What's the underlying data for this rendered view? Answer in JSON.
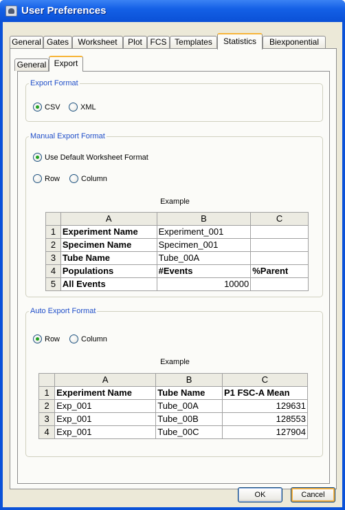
{
  "window": {
    "title": "User Preferences"
  },
  "top_tabs": [
    {
      "label": "General"
    },
    {
      "label": "Gates"
    },
    {
      "label": "Worksheet"
    },
    {
      "label": "Plot"
    },
    {
      "label": "FCS"
    },
    {
      "label": "Templates"
    },
    {
      "label": "Statistics",
      "active": true
    },
    {
      "label": "Biexponential"
    }
  ],
  "sub_tabs": [
    {
      "label": "General"
    },
    {
      "label": "Export",
      "active": true
    }
  ],
  "export_format": {
    "legend": "Export Format",
    "options": [
      {
        "label": "CSV",
        "selected": true
      },
      {
        "label": "XML",
        "selected": false
      }
    ]
  },
  "manual_export": {
    "legend": "Manual Export Format",
    "default_option": {
      "label": "Use Default Worksheet Format",
      "selected": true
    },
    "row_option": {
      "label": "Row",
      "selected": false
    },
    "column_option": {
      "label": "Column",
      "selected": false
    },
    "example_label": "Example",
    "table": {
      "columns": [
        "",
        "A",
        "B",
        "C"
      ],
      "rows": [
        [
          "1",
          "Experiment Name",
          "Experiment_001",
          ""
        ],
        [
          "2",
          "Specimen Name",
          "Specimen_001",
          ""
        ],
        [
          "3",
          "Tube Name",
          "Tube_00A",
          ""
        ],
        [
          "4",
          "Populations",
          "#Events",
          "%Parent"
        ],
        [
          "5",
          "All Events",
          "10000",
          ""
        ]
      ]
    }
  },
  "auto_export": {
    "legend": "Auto Export Format",
    "row_option": {
      "label": "Row",
      "selected": true
    },
    "column_option": {
      "label": "Column",
      "selected": false
    },
    "example_label": "Example",
    "table": {
      "columns": [
        "",
        "A",
        "B",
        "C"
      ],
      "rows": [
        [
          "1",
          "Experiment Name",
          "Tube Name",
          "P1 FSC-A Mean"
        ],
        [
          "2",
          "Exp_001",
          "Tube_00A",
          "129631"
        ],
        [
          "3",
          "Exp_001",
          "Tube_00B",
          "128553"
        ],
        [
          "4",
          "Exp_001",
          "Tube_00C",
          "127904"
        ]
      ]
    }
  },
  "buttons": {
    "ok": "OK",
    "cancel": "Cancel"
  },
  "colors": {
    "title_bar": "#0a52d8",
    "group_legend": "#1f4ec9",
    "active_tab_accent": "#f7b437",
    "radio_selected": "#21a121"
  }
}
